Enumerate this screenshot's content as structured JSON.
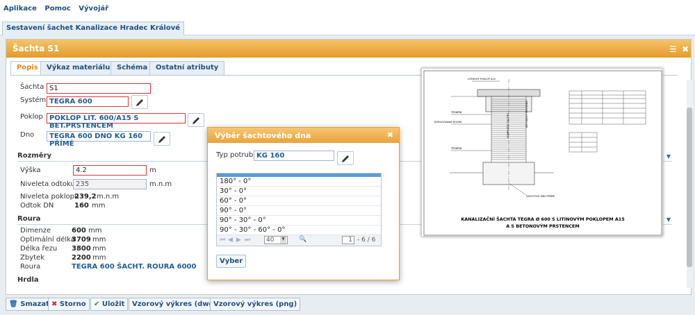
{
  "menu": [
    "Aplikace",
    "Pomoc",
    "Vývojář"
  ],
  "doc_tab": "Sestavení šachet Kanalizace Hradec Králové",
  "panel": {
    "title": "Šachta S1"
  },
  "tabs": [
    "Popis",
    "Výkaz materiálu",
    "Schéma",
    "Ostatní atributy"
  ],
  "form": {
    "sachta_label": "Šachta",
    "sachta_value": "S1",
    "system_label": "Systém",
    "system_value": "TEGRA 600",
    "poklop_label": "Poklop",
    "poklop_value": "POKLOP LIT. 600/A15 S BET.PRSTENCEM",
    "dno_label": "Dno",
    "dno_value": "TEGRA 600 DNO KG 160 PŘÍMÉ"
  },
  "rozmery": {
    "title": "Rozměry",
    "vyska_label": "Výška",
    "vyska_value": "4.2",
    "vyska_unit": "m",
    "niveleta_odtoku_label": "Niveleta odtoku",
    "niveleta_odtoku_value": "235",
    "niveleta_odtoku_unit": "m.n.m",
    "niveleta_poklopu_label": "Niveleta poklopu",
    "niveleta_poklopu_value": "239,2",
    "niveleta_poklopu_unit": "m.n.m",
    "odtok_label": "Odtok DN",
    "odtok_value": "160",
    "odtok_unit": "mm"
  },
  "roura": {
    "title": "Roura",
    "dimenze_label": "Dimenze",
    "dimenze_value": "600",
    "dimenze_unit": "mm",
    "optimalni_label": "Optimální délka",
    "optimalni_value": "3709",
    "optimalni_unit": "mm",
    "delka_label": "Délka řezu",
    "delka_value": "3800",
    "delka_unit": "mm",
    "zbytek_label": "Zbytek",
    "zbytek_value": "2200",
    "zbytek_unit": "mm",
    "roura_label": "Roura",
    "roura_value": "TEGRA 600 ŠACHT. ROURA 6000"
  },
  "hrdla": {
    "title": "Hrdla"
  },
  "drawing": {
    "caption_line1": "KANALIZAČNÍ ŠACHTA TEGRA Ø 600 S LITINOVÝM POKLOPEM A15",
    "caption_line2": "A S BETONOVÝM PRSTENCEM",
    "label_poklop": "LITINOVÝ POKLOP A15",
    "label_prstenec": "BETONOVÝ PRSTENEC",
    "label_kompak": "KOMPAKTNÍ ŠACHTA",
    "label_tesneni1": "TĚSNĚNÍ",
    "label_korugovana": "KORUGOVANÁ ROURA",
    "label_tesneni2": "TĚSNĚNÍ",
    "label_dno": "ŠACHTOVÉ DNO PŘÍMÉ"
  },
  "dialog": {
    "title": "Výběr šachtového dna",
    "typ_label": "Typ potrubí",
    "typ_value": "KG 160",
    "rows": [
      "180° - 0°",
      "30° - 0°",
      "60° - 0°",
      "90° - 0°",
      "90° - 30° - 0°",
      "90° - 30° - 60° - 0°"
    ],
    "page_size": "40",
    "page": "1",
    "page_info": "- 6 / 6",
    "select_button": "Vyber"
  },
  "buttons": {
    "smazat": "Smazat",
    "storno": "Storno",
    "ulozit": "Uložit",
    "vzor_dwg": "Vzorový výkres (dwg)",
    "vzor_png": "Vzorový výkres (png)"
  },
  "colors": {
    "accent": "#e9a33a",
    "link": "#1f5e96",
    "error": "#dd3333"
  }
}
